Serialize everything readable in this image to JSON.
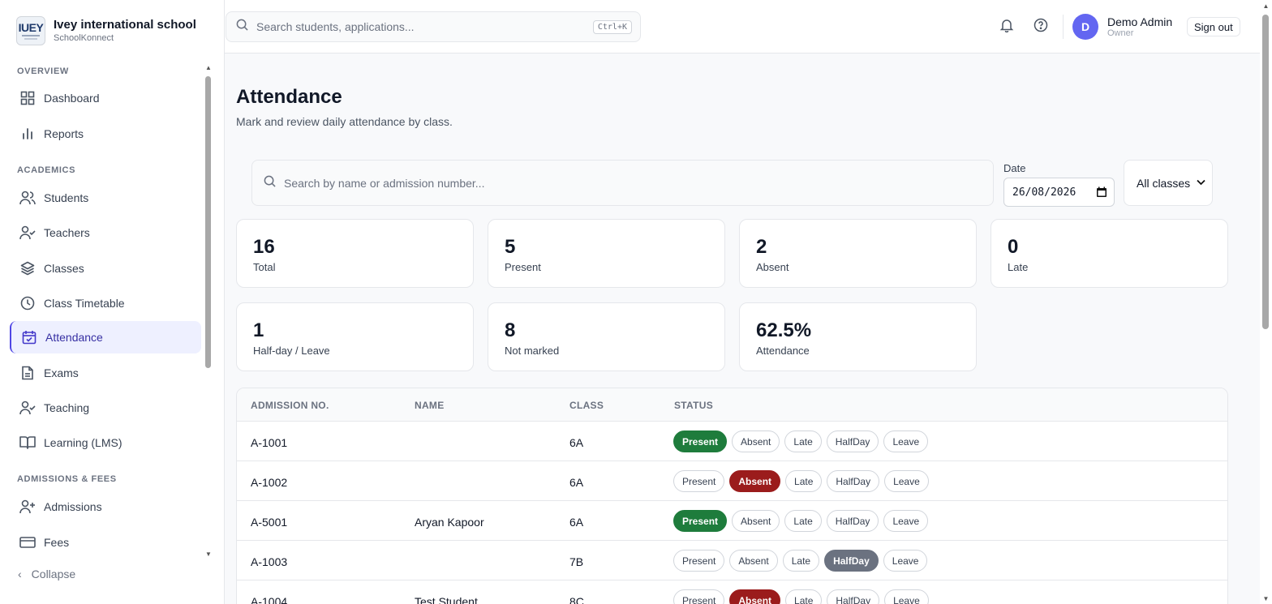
{
  "brand": {
    "name": "Ivey international school",
    "sub": "SchoolKonnect",
    "logo_text": "IUEY"
  },
  "sidebar": {
    "sections": [
      "OVERVIEW",
      "ACADEMICS",
      "ADMISSIONS & FEES"
    ],
    "items": [
      {
        "label": "Dashboard",
        "icon": "grid-icon"
      },
      {
        "label": "Reports",
        "icon": "bar-chart-icon"
      },
      {
        "label": "Students",
        "icon": "users-icon"
      },
      {
        "label": "Teachers",
        "icon": "user-check-icon"
      },
      {
        "label": "Classes",
        "icon": "layers-icon"
      },
      {
        "label": "Class Timetable",
        "icon": "clock-icon"
      },
      {
        "label": "Attendance",
        "icon": "calendar-check-icon",
        "active": true
      },
      {
        "label": "Exams",
        "icon": "file-text-icon"
      },
      {
        "label": "Teaching",
        "icon": "user-check-icon"
      },
      {
        "label": "Learning (LMS)",
        "icon": "book-open-icon"
      },
      {
        "label": "Admissions",
        "icon": "user-plus-icon"
      },
      {
        "label": "Fees",
        "icon": "credit-card-icon"
      }
    ],
    "collapse_label": "Collapse"
  },
  "topbar": {
    "search_placeholder": "Search students, applications...",
    "shortcut": "Ctrl+K",
    "user": {
      "initial": "D",
      "name": "Demo Admin",
      "role": "Owner"
    },
    "signout_label": "Sign out"
  },
  "page": {
    "title": "Attendance",
    "subtitle": "Mark and review daily attendance by class."
  },
  "filters": {
    "search_placeholder": "Search by name or admission number...",
    "date_label": "Date",
    "date_value": "26/08/2026",
    "class_select": "All classes"
  },
  "stats": [
    {
      "value": "16",
      "label": "Total"
    },
    {
      "value": "5",
      "label": "Present"
    },
    {
      "value": "2",
      "label": "Absent"
    },
    {
      "value": "0",
      "label": "Late"
    },
    {
      "value": "1",
      "label": "Half-day / Leave"
    },
    {
      "value": "8",
      "label": "Not marked"
    },
    {
      "value": "62.5%",
      "label": "Attendance"
    }
  ],
  "table": {
    "headers": [
      "ADMISSION NO.",
      "NAME",
      "CLASS",
      "STATUS"
    ],
    "status_options": [
      "Present",
      "Absent",
      "Late",
      "HalfDay",
      "Leave"
    ],
    "rows": [
      {
        "admission": "A-1001",
        "name": "",
        "class": "6A",
        "status": "Present"
      },
      {
        "admission": "A-1002",
        "name": "",
        "class": "6A",
        "status": "Absent"
      },
      {
        "admission": "A-5001",
        "name": "Aryan Kapoor",
        "class": "6A",
        "status": "Present"
      },
      {
        "admission": "A-1003",
        "name": "",
        "class": "7B",
        "status": "HalfDay"
      },
      {
        "admission": "A-1004",
        "name": "Test Student",
        "class": "8C",
        "status": "Absent"
      }
    ]
  },
  "colors": {
    "accent": "#4f46e5",
    "present": "#1e7c3c",
    "absent": "#9b1c1c",
    "halfday": "#6b7280"
  }
}
